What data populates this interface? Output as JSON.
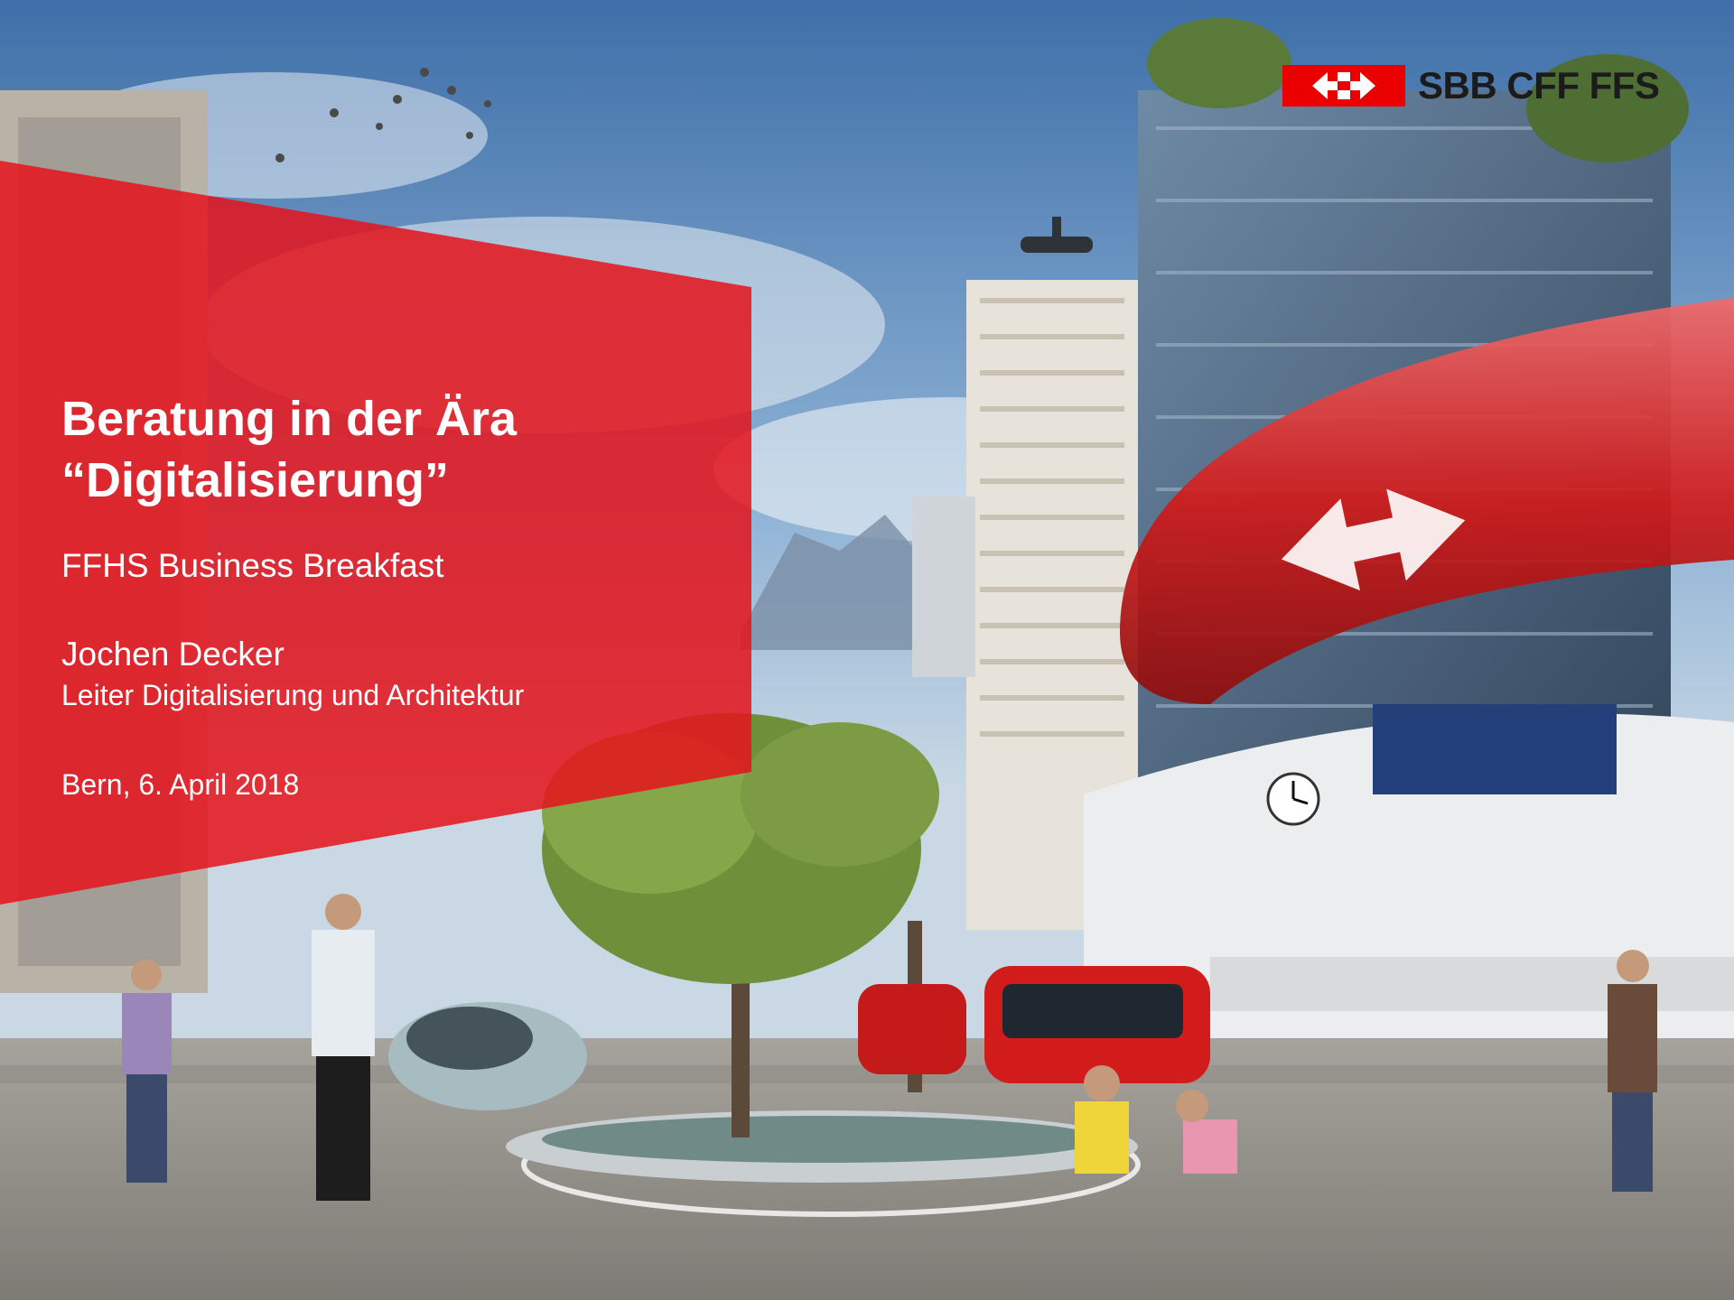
{
  "slide": {
    "title_line1": "Beratung in der Ära",
    "title_line2": "“Digitalisierung”",
    "subtitle": "FFHS Business Breakfast",
    "speaker_name": "Jochen Decker",
    "speaker_role": "Leiter Digitalisierung und Architektur",
    "date_line": "Bern, 6. April 2018"
  },
  "logo": {
    "icon": "sbb-arrows-icon",
    "text": "SBB CFF FFS"
  },
  "colors": {
    "brand_red": "#eb0000",
    "text_white": "#ffffff",
    "logo_text": "#1b1b1b"
  },
  "background": {
    "description_icons": [
      "city-scene",
      "station-building",
      "trees",
      "pedestrians",
      "buses",
      "drone",
      "birds"
    ]
  }
}
